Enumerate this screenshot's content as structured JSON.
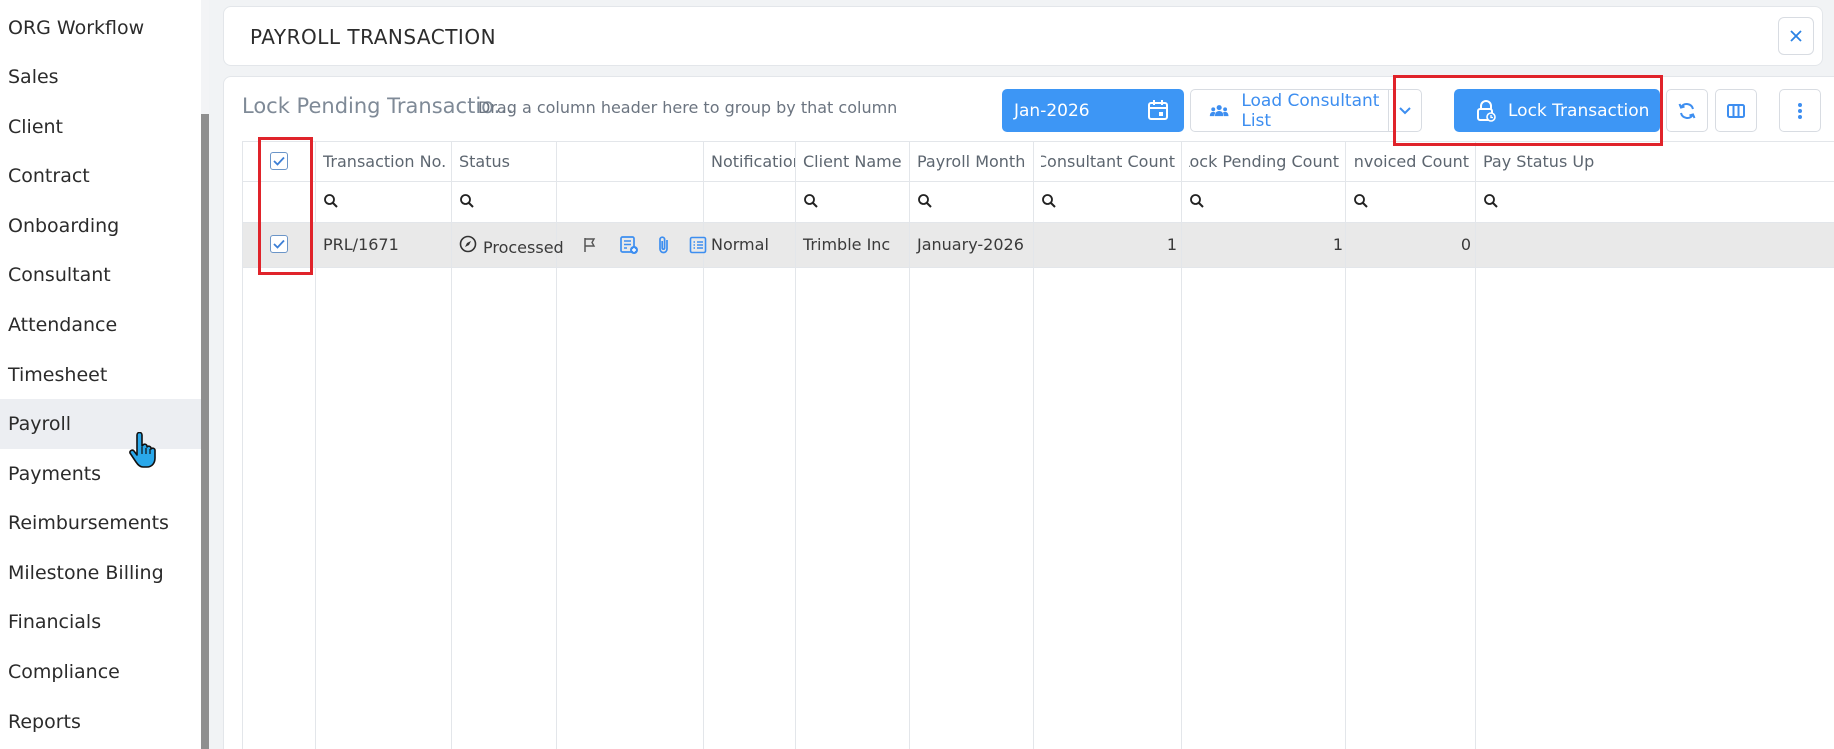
{
  "sidebar": {
    "items": [
      {
        "label": "ORG Workflow"
      },
      {
        "label": "Sales"
      },
      {
        "label": "Client"
      },
      {
        "label": "Contract"
      },
      {
        "label": "Onboarding"
      },
      {
        "label": "Consultant"
      },
      {
        "label": "Attendance"
      },
      {
        "label": "Timesheet"
      },
      {
        "label": "Payroll"
      },
      {
        "label": "Payments"
      },
      {
        "label": "Reimbursements"
      },
      {
        "label": "Milestone Billing"
      },
      {
        "label": "Financials"
      },
      {
        "label": "Compliance"
      },
      {
        "label": "Reports"
      }
    ],
    "active": "Payroll"
  },
  "header": {
    "title": "PAYROLL TRANSACTION",
    "close_icon": "×"
  },
  "grid": {
    "title": "Lock Pending Transactio...",
    "group_hint": "Drag a column header here to group by that column",
    "toolbar": {
      "month_value": "Jan-2026",
      "load_label": "Load Consultant List",
      "lock_label": "Lock Transaction"
    },
    "columns": [
      "Transaction No.",
      "Status",
      "",
      "Notification",
      "Client Name",
      "Payroll Month",
      "Consultant Count",
      "Lock Pending Count",
      "Invoiced Count",
      "Pay Status Up"
    ],
    "rows": [
      {
        "checked": true,
        "transaction_no": "PRL/1671",
        "status": "Processed",
        "notification": "Normal",
        "client_name": "Trimble Inc",
        "payroll_month": "January-2026",
        "consultant_count": "1",
        "lock_pending_count": "1",
        "invoiced_count": "0"
      }
    ]
  },
  "colors": {
    "accent": "#3d96f5",
    "highlight": "#e0232a",
    "row_selected": "#e9e9e9"
  }
}
